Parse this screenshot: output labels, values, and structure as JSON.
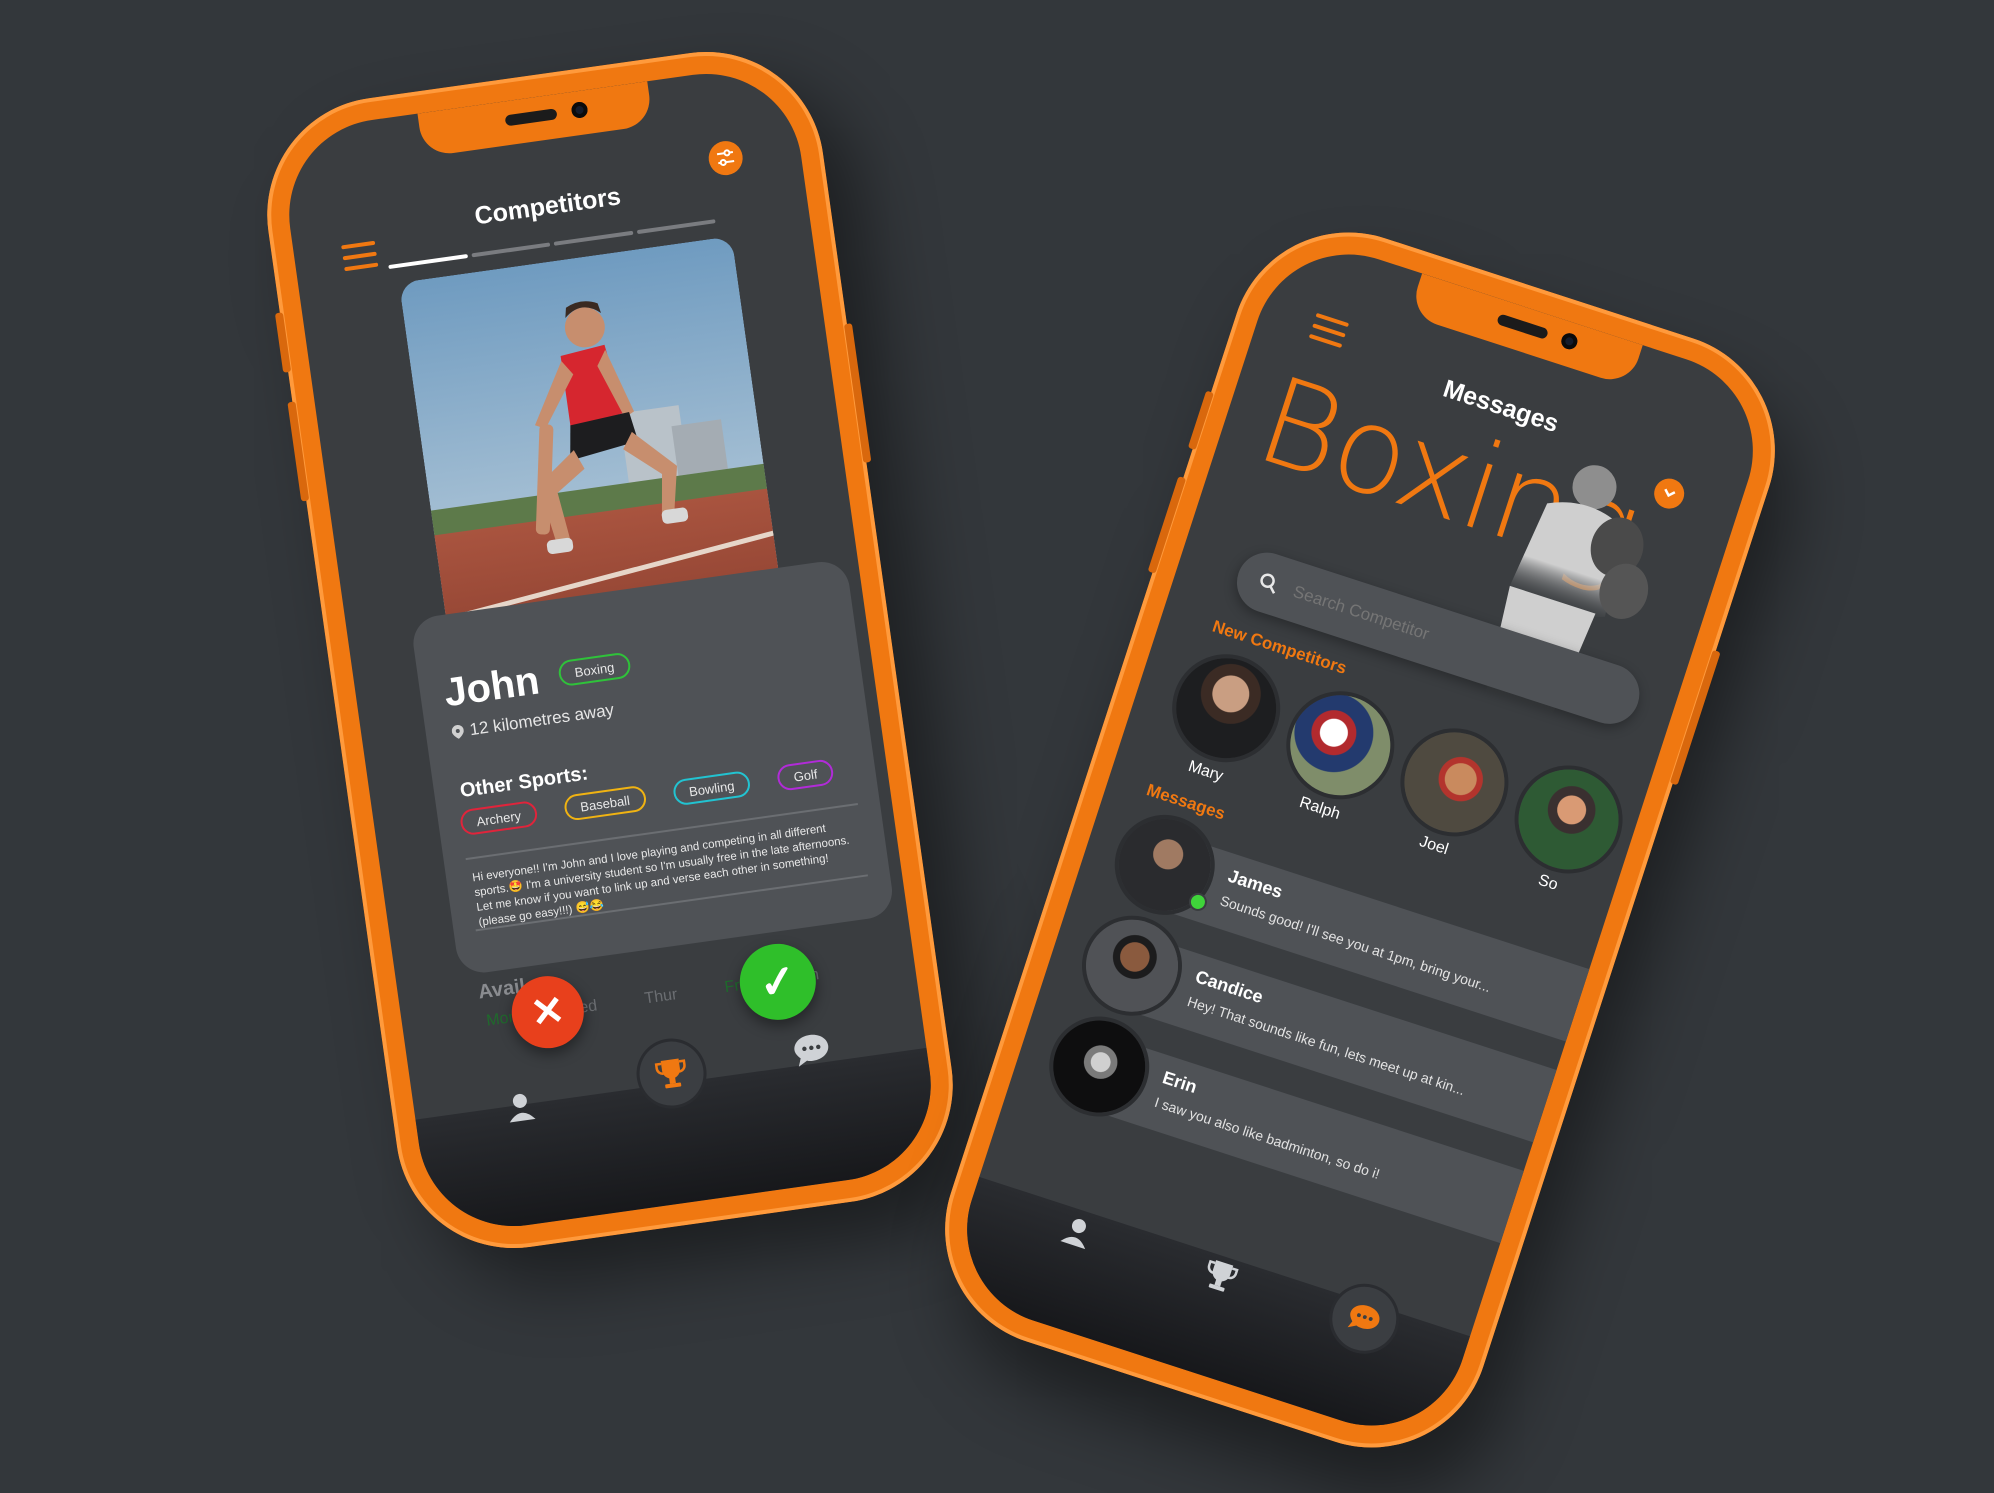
{
  "competitors_screen": {
    "title": "Competitors",
    "profile": {
      "name": "John",
      "main_sport": "Boxing",
      "distance": "12 kilometres away",
      "other_sports_heading": "Other Sports:",
      "other_sports": [
        {
          "label": "Archery",
          "color": "#e0243b"
        },
        {
          "label": "Baseball",
          "color": "#f0b312"
        },
        {
          "label": "Bowling",
          "color": "#22c3d1"
        },
        {
          "label": "Golf",
          "color": "#b12bd8"
        }
      ],
      "main_sport_color": "#2fc23a",
      "bio": "Hi everyone!! I'm John and I love playing and competing in all different sports.🤩 I'm a university student so I'm usually free in the late afternoons. Let me know if you want to link up and verse each other in something! (please go easy!!!) 😅😂",
      "availability_label": "Avail",
      "days": [
        "Mon",
        "Wed",
        "Thur",
        "Fri",
        "Sun"
      ]
    },
    "reject_icon": "✕",
    "accept_icon": "✓",
    "nav": {
      "profile_icon": "person-icon",
      "trophy_icon": "trophy-icon",
      "chat_icon": "chat-icon"
    }
  },
  "messages_screen": {
    "title": "Messages",
    "hero_text": "Boxing",
    "search_placeholder": "Search Competitor",
    "new_competitors_heading": "New Competitors",
    "new_competitors": [
      {
        "name": "Mary"
      },
      {
        "name": "Ralph"
      },
      {
        "name": "Joel"
      },
      {
        "name": "So"
      }
    ],
    "messages_heading": "Messages",
    "messages": [
      {
        "name": "James",
        "preview": "Sounds good! I'll see you at 1pm, bring your...",
        "online": true
      },
      {
        "name": "Candice",
        "preview": "Hey! That sounds like fun, lets meet up at kin...",
        "online": false
      },
      {
        "name": "Erin",
        "preview": "I saw you also like badminton, so do i!",
        "online": false
      }
    ]
  },
  "colors": {
    "accent": "#f07811",
    "background": "#33373b",
    "screen": "#3a3d40",
    "reject": "#e8401c",
    "accept": "#2fbf2a",
    "online": "#3fd43a"
  }
}
